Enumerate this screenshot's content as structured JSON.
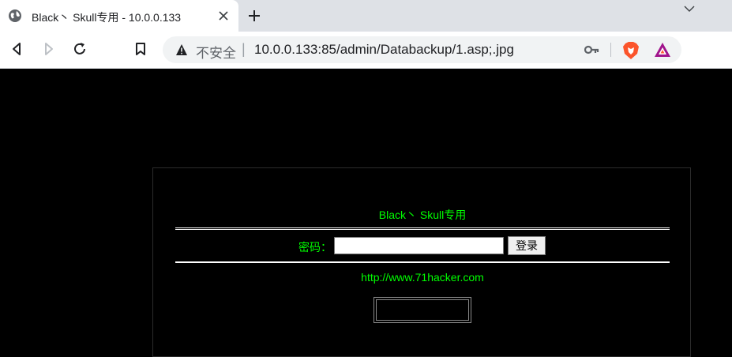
{
  "browser": {
    "tab_title": "Black丶 Skull专用 - 10.0.0.133",
    "security_label": "不安全",
    "url_separator": "|",
    "url": "10.0.0.133:85/admin/Databackup/1.asp;.jpg",
    "icons": {
      "favicon": "globe-icon",
      "tab_close": "close-icon",
      "new_tab": "plus-icon",
      "tab_search": "chevron-down-icon",
      "back": "back-arrow-icon",
      "forward": "forward-arrow-icon",
      "reload": "reload-icon",
      "bookmark": "bookmark-icon",
      "security": "warning-triangle-icon",
      "passwords": "key-icon",
      "brave_shields": "brave-lion-icon",
      "brave_rewards": "brave-rewards-triangle-icon"
    }
  },
  "page": {
    "title": "Black丶 Skull专用",
    "password_label": "密码：",
    "password_value": "",
    "login_button": "登录",
    "link": "http://www.71hacker.com",
    "colors": {
      "background": "#000000",
      "text": "#00ff00",
      "rule": "#ffffff"
    }
  }
}
